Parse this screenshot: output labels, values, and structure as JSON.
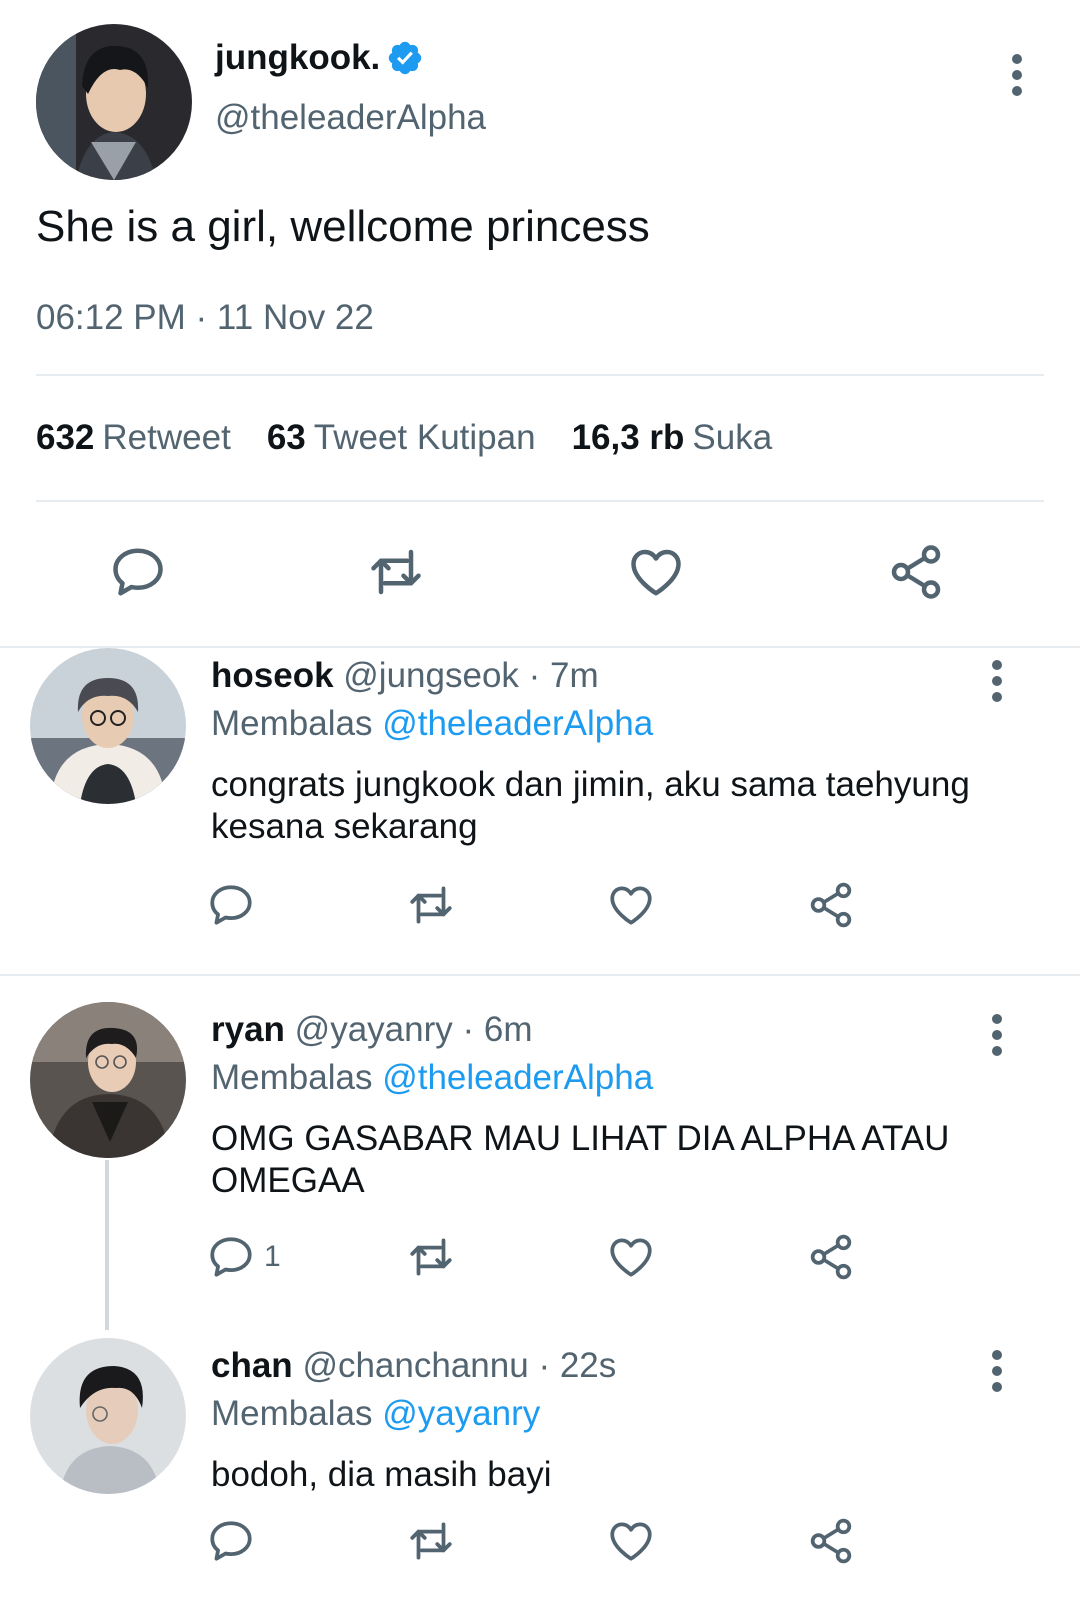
{
  "main_tweet": {
    "author_name": "jungkook.",
    "author_handle": "@theleaderAlpha",
    "text": "She is a girl, wellcome princess",
    "timestamp": "06:12 PM · 11 Nov 22",
    "stats": [
      {
        "value": "632",
        "label": "Retweet"
      },
      {
        "value": "63",
        "label": "Tweet Kutipan"
      },
      {
        "value": "16,3 rb",
        "label": "Suka"
      }
    ]
  },
  "replies": [
    {
      "name": "hoseok",
      "handle": "@jungseok",
      "time": "· 7m",
      "reply_prefix": "Membalas",
      "reply_to": "@theleaderAlpha",
      "text": "congrats jungkook dan jimin, aku sama taehyung kesana sekarang",
      "reply_count": ""
    },
    {
      "name": "ryan",
      "handle": "@yayanry",
      "time": "· 6m",
      "reply_prefix": "Membalas",
      "reply_to": "@theleaderAlpha",
      "text": "OMG GASABAR MAU LIHAT DIA ALPHA ATAU OMEGAA",
      "reply_count": "1"
    },
    {
      "name": "chan",
      "handle": "@chanchannu",
      "time": "· 22s",
      "reply_prefix": "Membalas",
      "reply_to": "@yayanry",
      "text": "bodoh, dia masih bayi",
      "reply_count": ""
    }
  ],
  "icons": [
    "verified-badge-icon",
    "more-vertical-icon",
    "reply-icon",
    "retweet-icon",
    "like-icon",
    "share-icon"
  ],
  "colors": {
    "accent": "#1d9bf0",
    "secondary_text": "#536471",
    "primary_text": "#0f1419",
    "divider": "#e6ecf0"
  }
}
